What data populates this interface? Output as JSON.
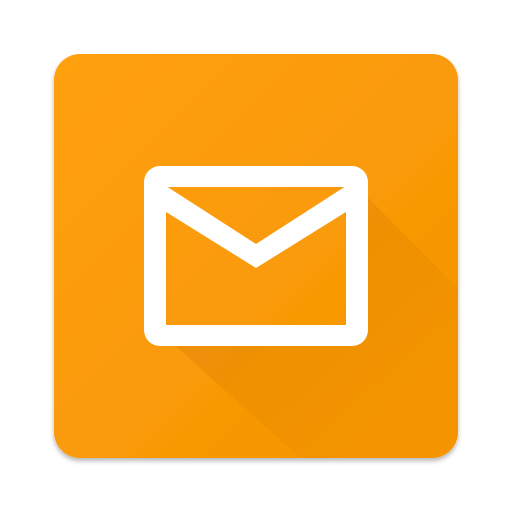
{
  "app_icon": {
    "icon": "mail-envelope-icon",
    "colors": {
      "background": "#FFA010",
      "background_dark": "#F59500",
      "shadow": "#C26A00",
      "glyph": "#FFFFFF"
    }
  }
}
